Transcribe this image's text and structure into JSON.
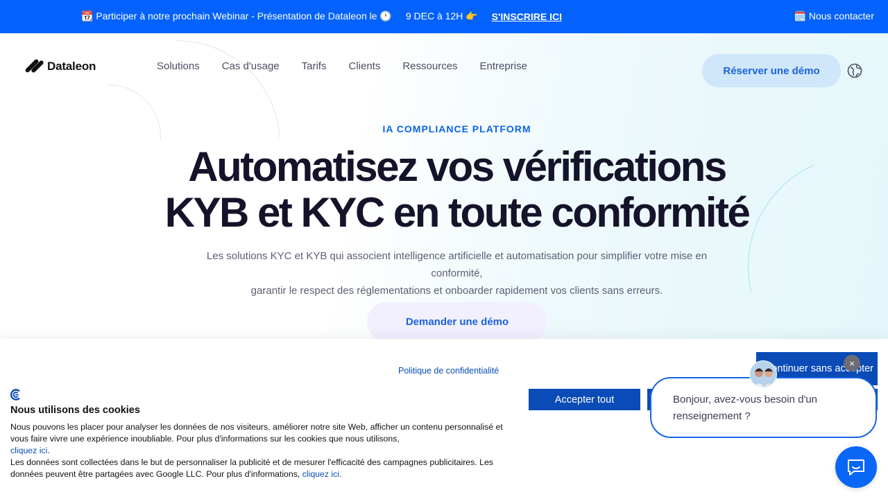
{
  "announcement": {
    "promo_text": "📆 Participer à notre prochain Webinar - Présentation de Dataleon le 🕐",
    "date_text": "9 DEC à 12H 👉",
    "signup_label": "S'INSCRIRE ICI",
    "contact_label": "🗓️ Nous contacter",
    "background_color": "#0362fc"
  },
  "header": {
    "logo_text": "Dataleon",
    "nav": [
      "Solutions",
      "Cas d'usage",
      "Tarifs",
      "Clients",
      "Ressources",
      "Entreprise"
    ],
    "demo_button": "Réserver une démo",
    "language_icon": "globe-icon"
  },
  "hero": {
    "eyebrow": "IA COMPLIANCE PLATFORM",
    "headline_line1": "Automatisez vos vérifications",
    "headline_line2": "KYB et KYC en toute conformité",
    "subtitle_line1": "Les solutions KYC et KYB qui associent intelligence artificielle et automatisation pour simplifier votre mise en conformité,",
    "subtitle_line2": "garantir le respect des réglementations et onboarder rapidement vos clients sans erreurs.",
    "cta_label": "Demander une démo"
  },
  "cookie_banner": {
    "privacy_link": "Politique de confidentialité",
    "title": "Nous utilisons des cookies",
    "text_part1": "Nous pouvons les placer pour analyser les données de nos visiteurs, améliorer notre site Web, afficher un contenu personnalisé et vous faire vivre une expérience inoubliable. Pour plus d'informations sur les cookies que nous utilisons,",
    "link1": "cliquez ici",
    "text_part2": "Les données sont collectées dans le but de personnaliser la publicité et de mesurer l'efficacité des campagnes publicitaires. Les données peuvent être partagées avec Google LLC. Pour plus d'informations,",
    "link2": "cliquez ici",
    "accept_label": "Accepter tout",
    "continue_label": "Continuer sans accepter",
    "button_color": "#0a4bb7"
  },
  "chat": {
    "message": "Bonjour, avez-vous besoin d'un renseignement ?",
    "close_label": "×",
    "launcher_icon": "chat-icon",
    "accent_color": "#0a66f5"
  }
}
